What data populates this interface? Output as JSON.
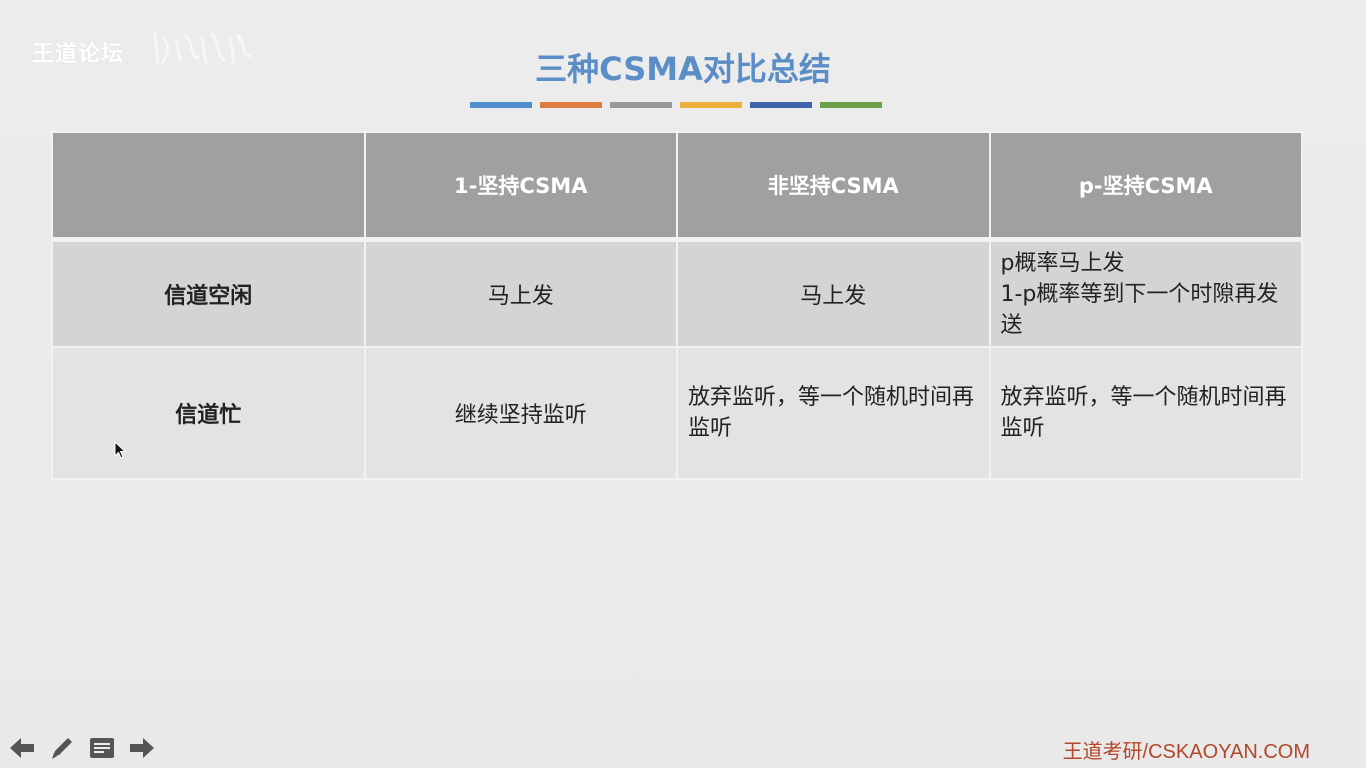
{
  "watermark": {
    "text": "王道论坛"
  },
  "title": "三种CSMA对比总结",
  "accent_bars": [
    "#4f8fcf",
    "#e07b3f",
    "#999999",
    "#e9b13b",
    "#3f64ab",
    "#6aa146"
  ],
  "table": {
    "headers": [
      "",
      "1-坚持CSMA",
      "非坚持CSMA",
      "p-坚持CSMA"
    ],
    "rows": [
      {
        "label": "信道空闲",
        "label_color": "#5e7d3c",
        "cells": [
          "马上发",
          "马上发",
          "p概率马上发\n1-p概率等到下一个时隙再发送"
        ]
      },
      {
        "label": "信道忙",
        "label_color": "#e02020",
        "cells": [
          "继续坚持监听",
          "放弃监听，等一个随机时间再监听",
          "放弃监听，等一个随机时间再监听"
        ]
      }
    ]
  },
  "nav_icons": [
    "arrow-left-icon",
    "pen-icon",
    "notes-icon",
    "arrow-right-icon"
  ],
  "footer": "王道考研/CSKAOYAN.COM"
}
